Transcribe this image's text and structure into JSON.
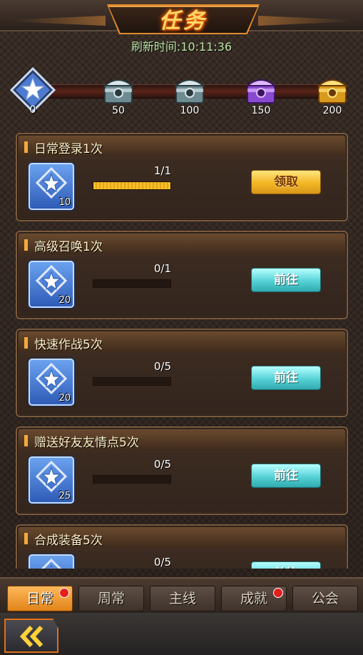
{
  "header": {
    "title": "任务",
    "refresh_label": "刷新时间:",
    "refresh_time": "10:11:36"
  },
  "progress": {
    "current": "0",
    "milestones": [
      {
        "value": "50",
        "chest": "silver-chest"
      },
      {
        "value": "100",
        "chest": "silver-chest"
      },
      {
        "value": "150",
        "chest": "purple-chest"
      },
      {
        "value": "200",
        "chest": "gold-chest"
      }
    ]
  },
  "tasks": [
    {
      "name": "日常登录1次",
      "reward": "10",
      "progress": "1/1",
      "ratio": 1,
      "button": "领取",
      "state": "claim"
    },
    {
      "name": "高级召唤1次",
      "reward": "20",
      "progress": "0/1",
      "ratio": 0,
      "button": "前往",
      "state": "go"
    },
    {
      "name": "快速作战5次",
      "reward": "20",
      "progress": "0/5",
      "ratio": 0,
      "button": "前往",
      "state": "go"
    },
    {
      "name": "赠送好友友情点5次",
      "reward": "25",
      "progress": "0/5",
      "ratio": 0,
      "button": "前往",
      "state": "go"
    },
    {
      "name": "合成装备5次",
      "reward": "",
      "progress": "0/5",
      "ratio": 0,
      "button": "前往",
      "state": "go"
    }
  ],
  "tabs": [
    {
      "label": "日常",
      "active": true,
      "dot": true
    },
    {
      "label": "周常",
      "active": false,
      "dot": false
    },
    {
      "label": "主线",
      "active": false,
      "dot": false
    },
    {
      "label": "成就",
      "active": false,
      "dot": true
    },
    {
      "label": "公会",
      "active": false,
      "dot": false
    }
  ],
  "colors": {
    "accent": "#f2b623",
    "go": "#56d2d6",
    "active_tab": "#e0841a"
  }
}
